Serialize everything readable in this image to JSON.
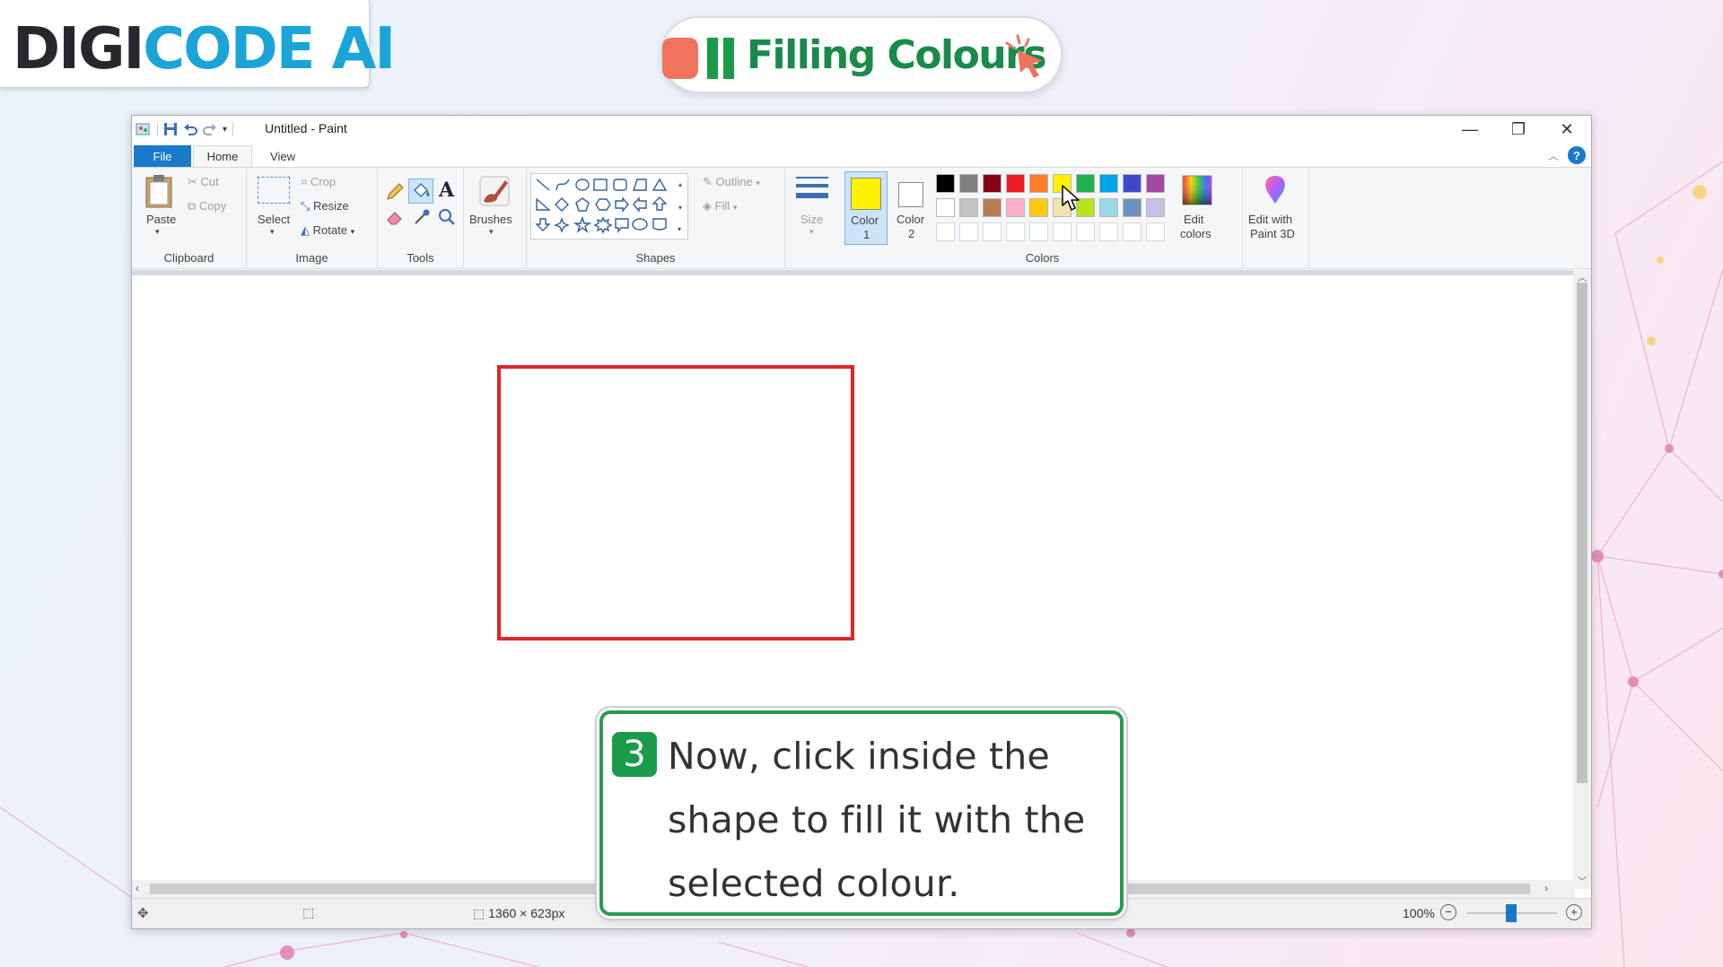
{
  "brand": {
    "part1": "DIGI",
    "part2": "CODE AI"
  },
  "lesson": {
    "title": "Filling Colours"
  },
  "window": {
    "title": "Untitled - Paint",
    "minimize": "—",
    "restore": "❐",
    "close": "✕"
  },
  "tabs": {
    "file": "File",
    "home": "Home",
    "view": "View",
    "help": "?"
  },
  "ribbon": {
    "clipboard": {
      "label": "Clipboard",
      "paste": "Paste",
      "cut": "Cut",
      "copy": "Copy"
    },
    "image": {
      "label": "Image",
      "select": "Select",
      "crop": "Crop",
      "resize": "Resize",
      "rotate": "Rotate"
    },
    "tools": {
      "label": "Tools"
    },
    "brushes": {
      "label": "Brushes"
    },
    "shapes": {
      "label": "Shapes",
      "outline": "Outline",
      "fill": "Fill"
    },
    "size": {
      "label": "Size"
    },
    "colors": {
      "label": "Colors",
      "color1_line1": "Color",
      "color1_line2": "1",
      "color2_line1": "Color",
      "color2_line2": "2",
      "edit_line1": "Edit",
      "edit_line2": "colors",
      "paint3d_line1": "Edit with",
      "paint3d_line2": "Paint 3D",
      "color1_value": "#fff200",
      "color2_value": "#ffffff",
      "palette_row1": [
        "#000000",
        "#7f7f7f",
        "#880015",
        "#ed1c24",
        "#ff7f27",
        "#fff200",
        "#22b14c",
        "#00a2e8",
        "#3f48cc",
        "#a349a4"
      ],
      "palette_row2": [
        "#ffffff",
        "#c3c3c3",
        "#b97a57",
        "#ffaec9",
        "#ffc90e",
        "#efe4b0",
        "#b5e61d",
        "#99d9ea",
        "#7092be",
        "#c8bfe7"
      ]
    }
  },
  "canvas": {
    "shape_color": "#e0252c"
  },
  "status": {
    "dimensions": "1360 × 623px",
    "zoom": "100%"
  },
  "instruction": {
    "step": "3",
    "line1": "Now, click inside the",
    "line2": "shape to fill it with the",
    "line3": "selected colour."
  }
}
